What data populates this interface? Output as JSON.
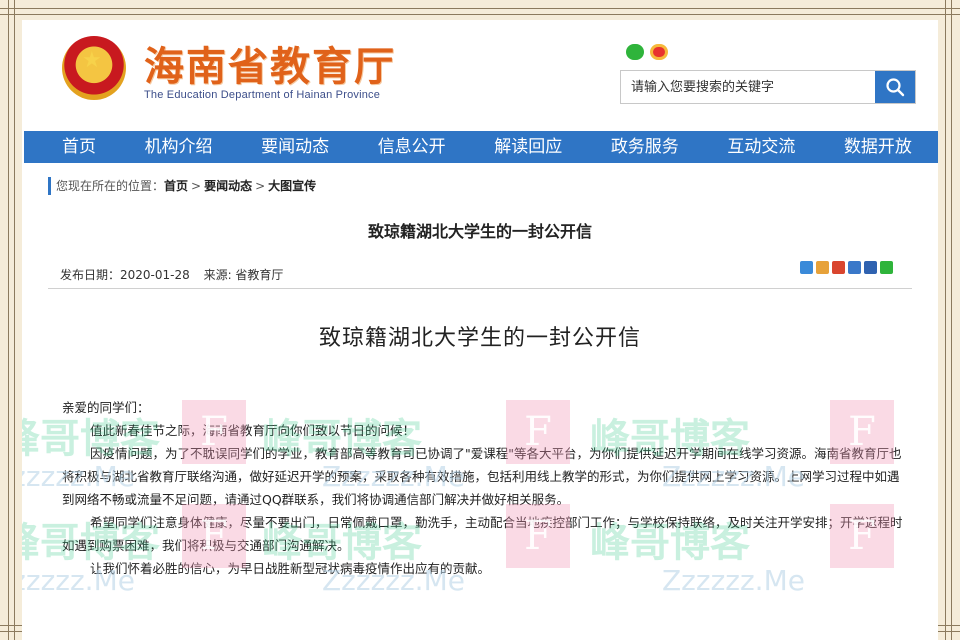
{
  "header": {
    "site_title": "海南省教育厅",
    "site_subtitle": "The Education Department of Hainan Province",
    "emblem_icon": "national-emblem-icon",
    "social_icons": [
      "wechat-icon",
      "weibo-icon"
    ],
    "search": {
      "placeholder": "请输入您要搜索的关键字",
      "button_icon": "search-icon"
    }
  },
  "nav": {
    "items": [
      "首页",
      "机构介绍",
      "要闻动态",
      "信息公开",
      "解读回应",
      "政务服务",
      "互动交流",
      "数据开放"
    ]
  },
  "breadcrumb": {
    "prefix": "您现在所在的位置：",
    "items": [
      "首页",
      "要闻动态",
      "大图宣传"
    ],
    "separator": ">"
  },
  "article": {
    "heading": "致琼籍湖北大学生的一封公开信",
    "publish_date_label": "发布日期：2020-01-28",
    "source_label": "来源: 省教育厅",
    "letter_title": "致琼籍湖北大学生的一封公开信",
    "paragraphs": [
      "亲爱的同学们：",
      "值此新春佳节之际，海南省教育厅向你们致以节日的问候！",
      "因疫情问题，为了不耽误同学们的学业，教育部高等教育司已协调了\"爱课程\"等各大平台，为你们提供延迟开学期间在线学习资源。海南省教育厅也将积极与湖北省教育厅联络沟通，做好延迟开学的预案，采取各种有效措施，包括利用线上教学的形式，为你们提供网上学习资源。上网学习过程中如遇到网络不畅或流量不足问题，请通过QQ群联系，我们将协调通信部门解决并做好相关服务。",
      "希望同学们注意身体健康，尽量不要出门，日常佩戴口罩，勤洗手，主动配合当地疾控部门工作；与学校保持联络，及时关注开学安排；开学返程时如遇到购票困难，我们将积极与交通部门沟通解决。",
      "让我们怀着必胜的信心，为早日战胜新型冠状病毒疫情作出应有的贡献。"
    ]
  },
  "share_icons": [
    "plus-share-icon",
    "qzone-icon",
    "weibo-share-icon",
    "renren-icon",
    "people-icon",
    "wechat-share-icon"
  ],
  "share_colors": [
    "#3a8ad9",
    "#e7a23a",
    "#d9452e",
    "#3a78c9",
    "#2f62b0",
    "#2fb43b"
  ],
  "watermark": {
    "text": "峰哥博客",
    "letter": "F",
    "url": "Zzzzzz.Me"
  },
  "colors": {
    "nav_bg": "#2f75c5",
    "title_orange": "#e0621a",
    "page_bg": "#f5ecd9"
  }
}
